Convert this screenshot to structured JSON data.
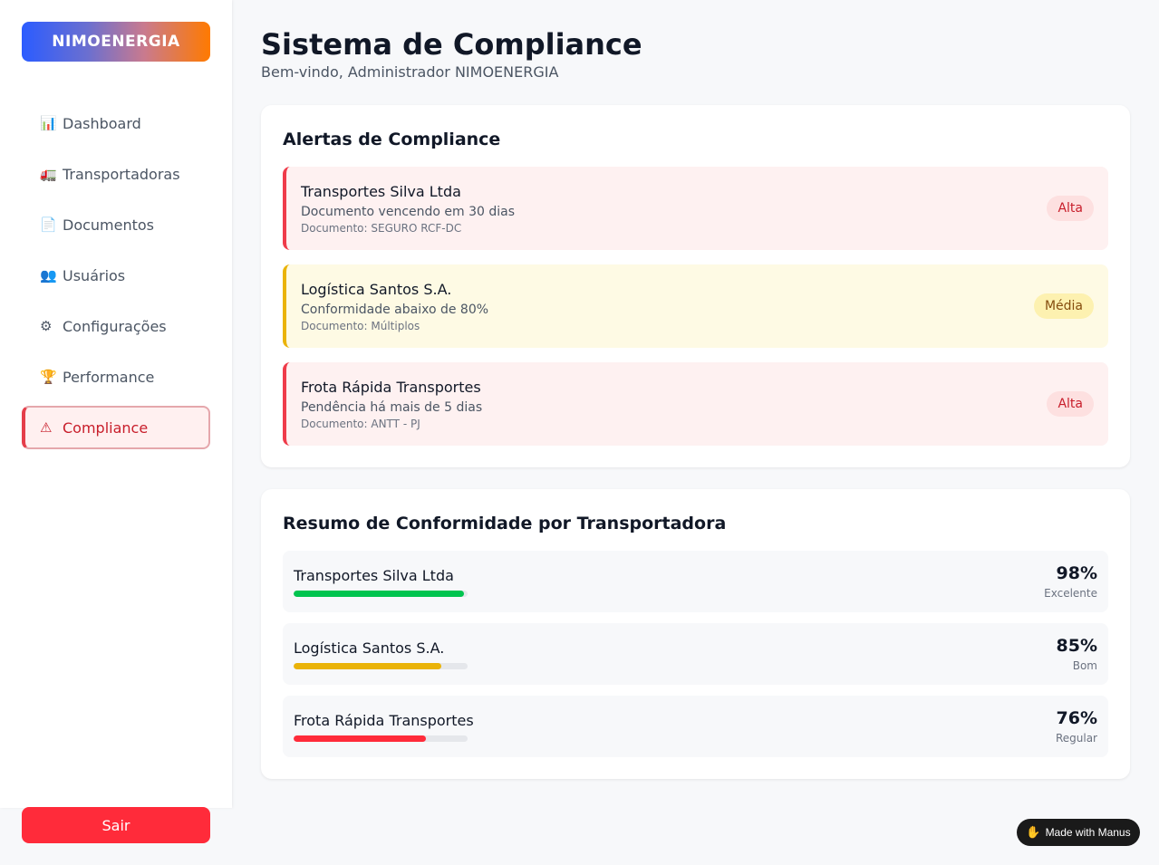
{
  "sidebar": {
    "logo": "NIMOENERGIA",
    "items": [
      {
        "icon": "📊",
        "icon_name": "bar-chart-icon",
        "label": "Dashboard",
        "active": false
      },
      {
        "icon": "🚛",
        "icon_name": "truck-icon",
        "label": "Transportadoras",
        "active": false
      },
      {
        "icon": "📄",
        "icon_name": "document-icon",
        "label": "Documentos",
        "active": false
      },
      {
        "icon": "👥",
        "icon_name": "users-icon",
        "label": "Usuários",
        "active": false
      },
      {
        "icon": "⚙",
        "icon_name": "gear-icon",
        "label": "Configurações",
        "active": false
      },
      {
        "icon": "🏆",
        "icon_name": "trophy-icon",
        "label": "Performance",
        "active": false
      },
      {
        "icon": "⚠",
        "icon_name": "warning-icon",
        "label": "Compliance",
        "active": true
      }
    ],
    "logout_label": "Sair"
  },
  "header": {
    "title": "Sistema de Compliance",
    "subtitle": "Bem-vindo, Administrador NIMOENERGIA"
  },
  "alerts": {
    "title": "Alertas de Compliance",
    "items": [
      {
        "name": "Transportes Silva Ltda",
        "description": "Documento vencendo em 30 dias",
        "document": "Documento: SEGURO RCF-DC",
        "priority": "Alta",
        "level": "high"
      },
      {
        "name": "Logística Santos S.A.",
        "description": "Conformidade abaixo de 80%",
        "document": "Documento: Múltiplos",
        "priority": "Média",
        "level": "med"
      },
      {
        "name": "Frota Rápida Transportes",
        "description": "Pendência há mais de 5 dias",
        "document": "Documento: ANTT - PJ",
        "priority": "Alta",
        "level": "high"
      }
    ]
  },
  "summary": {
    "title": "Resumo de Conformidade por Transportadora",
    "items": [
      {
        "name": "Transportes Silva Ltda",
        "percent_label": "98%",
        "percent": 98,
        "rating": "Excelente",
        "color": "#00c44f"
      },
      {
        "name": "Logística Santos S.A.",
        "percent_label": "85%",
        "percent": 85,
        "rating": "Bom",
        "color": "#eab308"
      },
      {
        "name": "Frota Rápida Transportes",
        "percent_label": "76%",
        "percent": 76,
        "rating": "Regular",
        "color": "#ff2b3a"
      }
    ]
  },
  "footer_badge": {
    "label": "Made with Manus",
    "icon_name": "manus-hand-icon"
  },
  "colors": {
    "accent_red": "#ff2b3a",
    "alert_high_border": "#ef3b4a",
    "alert_med_border": "#eab308"
  }
}
